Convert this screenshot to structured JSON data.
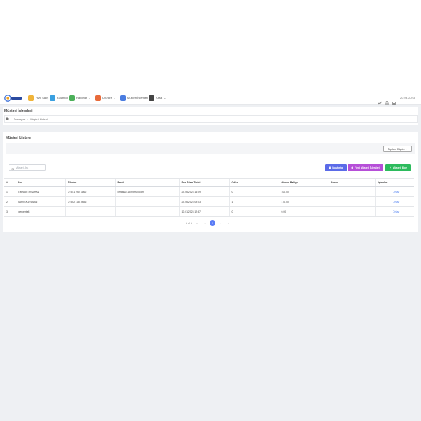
{
  "nav": {
    "items": [
      {
        "label": "Hızlı Satış",
        "icon": "crown-icon",
        "color": "#f0b43a",
        "has_menu": false
      },
      {
        "label": "Kullanıcı",
        "icon": "users-icon",
        "color": "#3aa0e0",
        "has_menu": false
      },
      {
        "label": "Raporlar",
        "icon": "report-icon",
        "color": "#4cb05a",
        "has_menu": true
      },
      {
        "label": "Ürünler",
        "icon": "box-icon",
        "color": "#e86a3a",
        "has_menu": true
      },
      {
        "label": "Müşteri İşlemleri",
        "icon": "customer-icon",
        "color": "#4a7ce0",
        "has_menu": false
      },
      {
        "label": "Kasa",
        "icon": "register-icon",
        "color": "#444444",
        "has_menu": true
      }
    ],
    "date": "22.06.2023"
  },
  "page": {
    "title": "Müşteri İşlemleri",
    "breadcrumb": [
      "Anasayfa",
      "Müşteri Listesi"
    ]
  },
  "list": {
    "title": "Müşteri Listele",
    "export_label": "Toplam Müşteri",
    "search_placeholder": "Müşteri Ara",
    "buttons": {
      "import": "Musteri al",
      "new_process": "Yeni Müşteri İşlemleri",
      "add": "Müşteri Ekle"
    },
    "columns": [
      "#",
      "Adı",
      "Telefon",
      "Email",
      "Son İşlem Tarihi",
      "Ödüz",
      "Güncel Bakiye",
      "Adres",
      "İşlemler"
    ],
    "rows": [
      {
        "no": "1",
        "name": "EMRAH ERBAHAN",
        "phone": "0 (541) 964 3662",
        "email": "Emrah2415@gmail.com",
        "last": "22.06.2023 14:09",
        "odu": "0",
        "balance": "100.00",
        "address": "",
        "action": "Detay"
      },
      {
        "no": "2",
        "name": "BARIŞ KAYAHAN",
        "phone": "0 (552) 130 4856",
        "email": "",
        "last": "22.06.2023 09:03",
        "odu": "1",
        "balance": "170.00",
        "address": "",
        "action": "Detay"
      },
      {
        "no": "3",
        "name": "pendente4",
        "phone": "",
        "email": "",
        "last": "10.01.2023 12:37",
        "odu": "0",
        "balance": "0.00",
        "address": "",
        "action": "Detay"
      }
    ],
    "pager": {
      "info": "1 of 1",
      "first": "«",
      "prev": "‹",
      "current": "1",
      "next": "›",
      "last": "»"
    }
  }
}
